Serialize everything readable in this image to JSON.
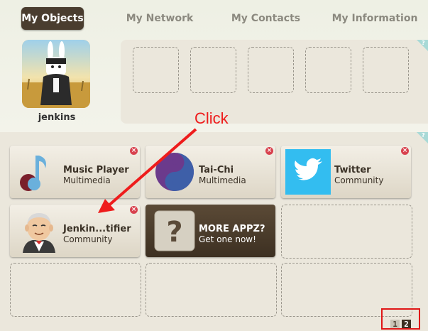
{
  "tabs": [
    {
      "label": "My Objects",
      "active": true
    },
    {
      "label": "My Network",
      "active": false
    },
    {
      "label": "My Contacts",
      "active": false
    },
    {
      "label": "My Information",
      "active": false
    }
  ],
  "profile": {
    "name": "jenkins"
  },
  "apps": [
    {
      "name": "Music Player",
      "category": "Multimedia",
      "icon": "music-note-icon"
    },
    {
      "name": "Tai-Chi",
      "category": "Multimedia",
      "icon": "tai-chi-icon"
    },
    {
      "name": "Twitter",
      "category": "Community",
      "icon": "twitter-bird-icon"
    },
    {
      "name": "Jenkin...tifier",
      "category": "Community",
      "icon": "jenkins-butler-icon"
    },
    {
      "name": "MORE APPZ?",
      "category": "Get one now!",
      "icon": "question-mark-icon"
    }
  ],
  "remove_glyph": "×",
  "corner_glyph": "?",
  "annotation": {
    "text": "Click",
    "color": "#ee1c1c"
  },
  "pager": {
    "pages": [
      "1",
      "2"
    ],
    "current": "2"
  },
  "colors": {
    "active_tab": "#4a3d2f",
    "panel": "#ebe7dc",
    "remove": "#d8424f",
    "twitter": "#33bdf0"
  }
}
